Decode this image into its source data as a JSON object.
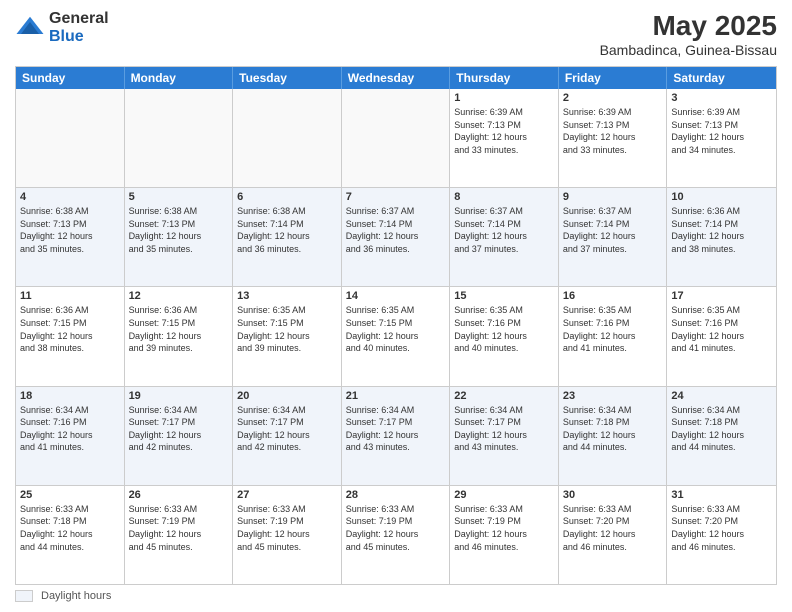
{
  "logo": {
    "general": "General",
    "blue": "Blue"
  },
  "header": {
    "month_year": "May 2025",
    "location": "Bambadinca, Guinea-Bissau"
  },
  "day_headers": [
    "Sunday",
    "Monday",
    "Tuesday",
    "Wednesday",
    "Thursday",
    "Friday",
    "Saturday"
  ],
  "weeks": [
    [
      {
        "day": "",
        "info": "",
        "empty": true
      },
      {
        "day": "",
        "info": "",
        "empty": true
      },
      {
        "day": "",
        "info": "",
        "empty": true
      },
      {
        "day": "",
        "info": "",
        "empty": true
      },
      {
        "day": "1",
        "info": "Sunrise: 6:39 AM\nSunset: 7:13 PM\nDaylight: 12 hours\nand 33 minutes.",
        "empty": false
      },
      {
        "day": "2",
        "info": "Sunrise: 6:39 AM\nSunset: 7:13 PM\nDaylight: 12 hours\nand 33 minutes.",
        "empty": false
      },
      {
        "day": "3",
        "info": "Sunrise: 6:39 AM\nSunset: 7:13 PM\nDaylight: 12 hours\nand 34 minutes.",
        "empty": false
      }
    ],
    [
      {
        "day": "4",
        "info": "Sunrise: 6:38 AM\nSunset: 7:13 PM\nDaylight: 12 hours\nand 35 minutes.",
        "empty": false
      },
      {
        "day": "5",
        "info": "Sunrise: 6:38 AM\nSunset: 7:13 PM\nDaylight: 12 hours\nand 35 minutes.",
        "empty": false
      },
      {
        "day": "6",
        "info": "Sunrise: 6:38 AM\nSunset: 7:14 PM\nDaylight: 12 hours\nand 36 minutes.",
        "empty": false
      },
      {
        "day": "7",
        "info": "Sunrise: 6:37 AM\nSunset: 7:14 PM\nDaylight: 12 hours\nand 36 minutes.",
        "empty": false
      },
      {
        "day": "8",
        "info": "Sunrise: 6:37 AM\nSunset: 7:14 PM\nDaylight: 12 hours\nand 37 minutes.",
        "empty": false
      },
      {
        "day": "9",
        "info": "Sunrise: 6:37 AM\nSunset: 7:14 PM\nDaylight: 12 hours\nand 37 minutes.",
        "empty": false
      },
      {
        "day": "10",
        "info": "Sunrise: 6:36 AM\nSunset: 7:14 PM\nDaylight: 12 hours\nand 38 minutes.",
        "empty": false
      }
    ],
    [
      {
        "day": "11",
        "info": "Sunrise: 6:36 AM\nSunset: 7:15 PM\nDaylight: 12 hours\nand 38 minutes.",
        "empty": false
      },
      {
        "day": "12",
        "info": "Sunrise: 6:36 AM\nSunset: 7:15 PM\nDaylight: 12 hours\nand 39 minutes.",
        "empty": false
      },
      {
        "day": "13",
        "info": "Sunrise: 6:35 AM\nSunset: 7:15 PM\nDaylight: 12 hours\nand 39 minutes.",
        "empty": false
      },
      {
        "day": "14",
        "info": "Sunrise: 6:35 AM\nSunset: 7:15 PM\nDaylight: 12 hours\nand 40 minutes.",
        "empty": false
      },
      {
        "day": "15",
        "info": "Sunrise: 6:35 AM\nSunset: 7:16 PM\nDaylight: 12 hours\nand 40 minutes.",
        "empty": false
      },
      {
        "day": "16",
        "info": "Sunrise: 6:35 AM\nSunset: 7:16 PM\nDaylight: 12 hours\nand 41 minutes.",
        "empty": false
      },
      {
        "day": "17",
        "info": "Sunrise: 6:35 AM\nSunset: 7:16 PM\nDaylight: 12 hours\nand 41 minutes.",
        "empty": false
      }
    ],
    [
      {
        "day": "18",
        "info": "Sunrise: 6:34 AM\nSunset: 7:16 PM\nDaylight: 12 hours\nand 41 minutes.",
        "empty": false
      },
      {
        "day": "19",
        "info": "Sunrise: 6:34 AM\nSunset: 7:17 PM\nDaylight: 12 hours\nand 42 minutes.",
        "empty": false
      },
      {
        "day": "20",
        "info": "Sunrise: 6:34 AM\nSunset: 7:17 PM\nDaylight: 12 hours\nand 42 minutes.",
        "empty": false
      },
      {
        "day": "21",
        "info": "Sunrise: 6:34 AM\nSunset: 7:17 PM\nDaylight: 12 hours\nand 43 minutes.",
        "empty": false
      },
      {
        "day": "22",
        "info": "Sunrise: 6:34 AM\nSunset: 7:17 PM\nDaylight: 12 hours\nand 43 minutes.",
        "empty": false
      },
      {
        "day": "23",
        "info": "Sunrise: 6:34 AM\nSunset: 7:18 PM\nDaylight: 12 hours\nand 44 minutes.",
        "empty": false
      },
      {
        "day": "24",
        "info": "Sunrise: 6:34 AM\nSunset: 7:18 PM\nDaylight: 12 hours\nand 44 minutes.",
        "empty": false
      }
    ],
    [
      {
        "day": "25",
        "info": "Sunrise: 6:33 AM\nSunset: 7:18 PM\nDaylight: 12 hours\nand 44 minutes.",
        "empty": false
      },
      {
        "day": "26",
        "info": "Sunrise: 6:33 AM\nSunset: 7:19 PM\nDaylight: 12 hours\nand 45 minutes.",
        "empty": false
      },
      {
        "day": "27",
        "info": "Sunrise: 6:33 AM\nSunset: 7:19 PM\nDaylight: 12 hours\nand 45 minutes.",
        "empty": false
      },
      {
        "day": "28",
        "info": "Sunrise: 6:33 AM\nSunset: 7:19 PM\nDaylight: 12 hours\nand 45 minutes.",
        "empty": false
      },
      {
        "day": "29",
        "info": "Sunrise: 6:33 AM\nSunset: 7:19 PM\nDaylight: 12 hours\nand 46 minutes.",
        "empty": false
      },
      {
        "day": "30",
        "info": "Sunrise: 6:33 AM\nSunset: 7:20 PM\nDaylight: 12 hours\nand 46 minutes.",
        "empty": false
      },
      {
        "day": "31",
        "info": "Sunrise: 6:33 AM\nSunset: 7:20 PM\nDaylight: 12 hours\nand 46 minutes.",
        "empty": false
      }
    ]
  ],
  "footer": {
    "daylight_label": "Daylight hours"
  }
}
